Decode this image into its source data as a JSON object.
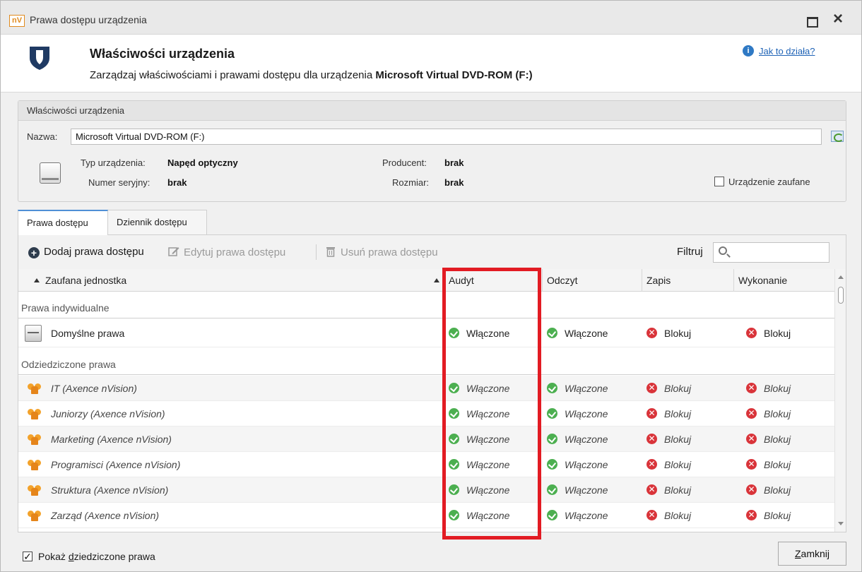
{
  "window": {
    "app_icon": "nV",
    "title": "Prawa dostępu urządzenia"
  },
  "header": {
    "title": "Właściwości urządzenia",
    "subtitle_prefix": "Zarządzaj właściwościami i prawami dostępu dla urządzenia ",
    "device_name": "Microsoft Virtual DVD-ROM (F:)",
    "help_icon": "i",
    "help_link": "Jak to działa?"
  },
  "properties": {
    "group_title": "Właściwości urządzenia",
    "name_label": "Nazwa:",
    "name_value": "Microsoft Virtual DVD-ROM (F:)",
    "type_label": "Typ urządzenia:",
    "type_value": "Napęd optyczny",
    "serial_label": "Numer seryjny:",
    "serial_value": "brak",
    "producer_label": "Producent:",
    "producer_value": "brak",
    "size_label": "Rozmiar:",
    "size_value": "brak",
    "trusted_label": "Urządzenie zaufane",
    "trusted_checked": false
  },
  "tabs": [
    {
      "label": "Prawa dostępu",
      "active": true
    },
    {
      "label": "Dziennik dostępu",
      "active": false
    }
  ],
  "toolbar": {
    "add_label": "Dodaj prawa dostępu",
    "add_icon": "+",
    "edit_label": "Edytuj prawa dostępu",
    "delete_label": "Usuń prawa dostępu",
    "filter_label": "Filtruj",
    "filter_value": ""
  },
  "grid": {
    "columns": [
      "Zaufana jednostka",
      "Audyt",
      "Odczyt",
      "Zapis",
      "Wykonanie"
    ],
    "group_individual": "Prawa indywidualne",
    "group_inherited": "Odziedziczone prawa",
    "default_row": {
      "name": "Domyślne prawa",
      "audit": "Włączone",
      "read": "Włączone",
      "write": "Blokuj",
      "exec": "Blokuj"
    },
    "inherited_rows": [
      {
        "name": "IT (Axence nVision)",
        "audit": "Włączone",
        "read": "Włączone",
        "write": "Blokuj",
        "exec": "Blokuj"
      },
      {
        "name": "Juniorzy (Axence nVision)",
        "audit": "Włączone",
        "read": "Włączone",
        "write": "Blokuj",
        "exec": "Blokuj"
      },
      {
        "name": "Marketing (Axence nVision)",
        "audit": "Włączone",
        "read": "Włączone",
        "write": "Blokuj",
        "exec": "Blokuj"
      },
      {
        "name": "Programisci (Axence nVision)",
        "audit": "Włączone",
        "read": "Włączone",
        "write": "Blokuj",
        "exec": "Blokuj"
      },
      {
        "name": "Struktura (Axence nVision)",
        "audit": "Włączone",
        "read": "Włączone",
        "write": "Blokuj",
        "exec": "Blokuj"
      },
      {
        "name": "Zarząd (Axence nVision)",
        "audit": "Włączone",
        "read": "Włączone",
        "write": "Blokuj",
        "exec": "Blokuj"
      }
    ],
    "deny_glyph": "✕"
  },
  "footer": {
    "show_inherited_pre": "Pokaż ",
    "show_inherited_ul": "d",
    "show_inherited_post": "ziedziczone prawa",
    "show_inherited_checked": true,
    "checkmark": "✓",
    "close_ul": "Z",
    "close_rest": "amknij"
  },
  "colors": {
    "accent": "#4f8fd6",
    "ok": "#4caf50",
    "block": "#d9343a",
    "highlight": "#e21b23"
  }
}
